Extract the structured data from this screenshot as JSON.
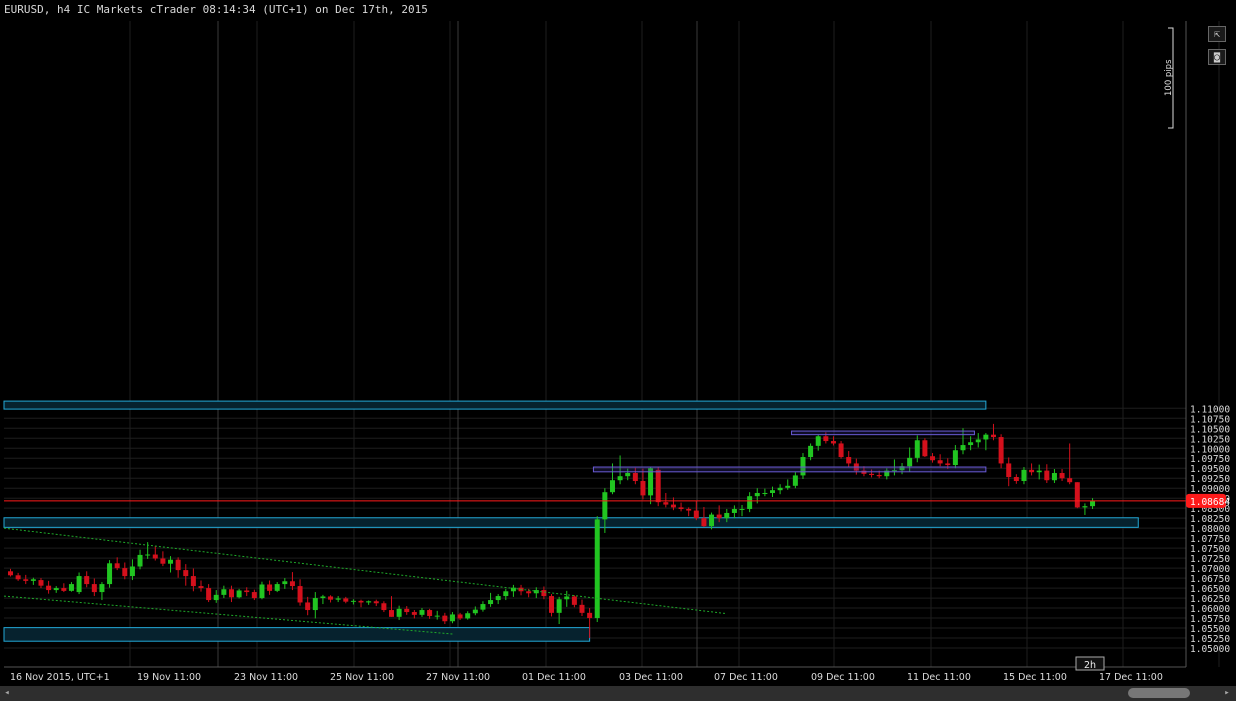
{
  "window": {
    "title": "EURUSD, h4 IC Markets cTrader 08:14:34 (UTC+1) on Dec 17th, 2015"
  },
  "toolbar": {
    "popout_icon": "popout-icon",
    "screenshot_icon": "camera-icon",
    "popout_glyph": "⇱",
    "screenshot_glyph": "◙"
  },
  "period_badge": "2h",
  "ruler_label": "100 pips",
  "scrollbar": {
    "left_arrow": "◂",
    "right_arrow": "▸"
  },
  "colors": {
    "background": "#000000",
    "grid": "#1e1e1e",
    "bull": "#21c521",
    "bear": "#d4101c",
    "price_line": "#ff1a1a",
    "zone_fill": "#06222e",
    "zone_stroke": "#23a8d6",
    "box_stroke": "#6a5bd6",
    "trend": "#1faa2a",
    "axis_text": "#dcdcdc"
  },
  "chart_data": {
    "type": "candlestick",
    "symbol": "EURUSD",
    "timeframe": "h4",
    "ylim": [
      1.049,
      1.1125
    ],
    "y_ticks": [
      "1.05000",
      "1.05250",
      "1.05500",
      "1.05750",
      "1.06000",
      "1.06250",
      "1.06500",
      "1.06750",
      "1.07000",
      "1.07250",
      "1.07500",
      "1.07750",
      "1.08000",
      "1.08250",
      "1.08500",
      "1.08750",
      "1.09000",
      "1.09250",
      "1.09500",
      "1.09750",
      "1.10000",
      "1.10250",
      "1.10500",
      "1.10750",
      "1.11000"
    ],
    "x_ticks": [
      "16 Nov 2015, UTC+1",
      "19 Nov 11:00",
      "23 Nov 11:00",
      "25 Nov 11:00",
      "27 Nov 11:00",
      "01 Dec 11:00",
      "03 Dec 11:00",
      "07 Dec 11:00",
      "09 Dec 11:00",
      "11 Dec 11:00",
      "15 Dec 11:00",
      "17 Dec 11:00"
    ],
    "current_price": {
      "value": 1.08684,
      "label": "1.08684"
    },
    "grid": true,
    "session_separators": [
      21,
      50,
      80
    ],
    "zones": [
      {
        "name": "supply-zone-top",
        "y1": 1.1098,
        "y2": 1.1118,
        "x1": 0,
        "x2": 128
      },
      {
        "name": "demand-zone-middle",
        "y1": 1.0802,
        "y2": 1.0826,
        "x1": 0,
        "x2": 148
      },
      {
        "name": "demand-zone-bottom",
        "y1": 1.0517,
        "y2": 1.0551,
        "x1": 0,
        "x2": 76
      }
    ],
    "boxes": [
      {
        "name": "resistance-box-upper",
        "y1": 1.1034,
        "y2": 1.1043,
        "x1": 102.5,
        "x2": 126.5
      },
      {
        "name": "resistance-box-lower",
        "y1": 1.0941,
        "y2": 1.0953,
        "x1": 76.5,
        "x2": 128
      }
    ],
    "trendlines": [
      {
        "name": "upper-trendline",
        "x1": 0,
        "y1": 1.08,
        "x2": 94,
        "y2": 1.0586
      },
      {
        "name": "lower-trendline",
        "x1": 0,
        "y1": 1.063,
        "x2": 58,
        "y2": 1.0535
      }
    ],
    "candles": [
      [
        1.0692,
        1.0698,
        1.0679,
        1.0682
      ],
      [
        1.0682,
        1.0688,
        1.0668,
        1.0672
      ],
      [
        1.0672,
        1.0683,
        1.066,
        1.0668
      ],
      [
        1.0668,
        1.0676,
        1.0658,
        1.0672
      ],
      [
        1.067,
        1.0675,
        1.065,
        1.0656
      ],
      [
        1.0656,
        1.0668,
        1.0636,
        1.0645
      ],
      [
        1.0645,
        1.0655,
        1.0638,
        1.065
      ],
      [
        1.065,
        1.0662,
        1.064,
        1.0643
      ],
      [
        1.0643,
        1.0665,
        1.0641,
        1.066
      ],
      [
        1.064,
        1.0689,
        1.0635,
        1.068
      ],
      [
        1.068,
        1.0692,
        1.0652,
        1.066
      ],
      [
        1.066,
        1.0674,
        1.063,
        1.064
      ],
      [
        1.064,
        1.0665,
        1.062,
        1.066
      ],
      [
        1.066,
        1.072,
        1.0651,
        1.0712
      ],
      [
        1.0712,
        1.0727,
        1.0695,
        1.07
      ],
      [
        1.07,
        1.0714,
        1.0672,
        1.068
      ],
      [
        1.068,
        1.0722,
        1.067,
        1.0704
      ],
      [
        1.0704,
        1.0746,
        1.0697,
        1.0733
      ],
      [
        1.0733,
        1.0765,
        1.0723,
        1.0734
      ],
      [
        1.0734,
        1.0755,
        1.0719,
        1.0724
      ],
      [
        1.0724,
        1.0742,
        1.0705,
        1.0711
      ],
      [
        1.0711,
        1.073,
        1.0689,
        1.0721
      ],
      [
        1.0721,
        1.0727,
        1.0676,
        1.0695
      ],
      [
        1.0695,
        1.071,
        1.0656,
        1.068
      ],
      [
        1.068,
        1.0699,
        1.0642,
        1.0655
      ],
      [
        1.0655,
        1.0669,
        1.0641,
        1.065
      ],
      [
        1.065,
        1.066,
        1.0615,
        1.062
      ],
      [
        1.062,
        1.0645,
        1.0613,
        1.0633
      ],
      [
        1.0633,
        1.0656,
        1.0625,
        1.0647
      ],
      [
        1.0647,
        1.0656,
        1.0615,
        1.0627
      ],
      [
        1.0627,
        1.0648,
        1.0624,
        1.0644
      ],
      [
        1.0644,
        1.0652,
        1.063,
        1.064
      ],
      [
        1.064,
        1.0646,
        1.062,
        1.0625
      ],
      [
        1.0625,
        1.0666,
        1.0622,
        1.0659
      ],
      [
        1.0659,
        1.0669,
        1.0633,
        1.0643
      ],
      [
        1.0643,
        1.0665,
        1.064,
        1.066
      ],
      [
        1.066,
        1.0675,
        1.0648,
        1.0667
      ],
      [
        1.0667,
        1.069,
        1.0645,
        1.0655
      ],
      [
        1.0655,
        1.0672,
        1.0606,
        1.0614
      ],
      [
        1.0614,
        1.0628,
        1.0582,
        1.0595
      ],
      [
        1.0595,
        1.064,
        1.0574,
        1.0625
      ],
      [
        1.0625,
        1.0633,
        1.061,
        1.0629
      ],
      [
        1.0629,
        1.0632,
        1.0614,
        1.0621
      ],
      [
        1.0621,
        1.063,
        1.0615,
        1.0624
      ],
      [
        1.0624,
        1.0628,
        1.0612,
        1.0616
      ],
      [
        1.0616,
        1.0622,
        1.0609,
        1.0618
      ],
      [
        1.0618,
        1.0621,
        1.0602,
        1.0614
      ],
      [
        1.0614,
        1.0619,
        1.0608,
        1.0617
      ],
      [
        1.0617,
        1.0621,
        1.0605,
        1.0612
      ],
      [
        1.0612,
        1.0617,
        1.059,
        1.0595
      ],
      [
        1.0595,
        1.063,
        1.0578,
        1.0578
      ],
      [
        1.0578,
        1.0606,
        1.057,
        1.0598
      ],
      [
        1.0598,
        1.0605,
        1.0583,
        1.059
      ],
      [
        1.059,
        1.0595,
        1.0574,
        1.0583
      ],
      [
        1.0583,
        1.06,
        1.0578,
        1.0595
      ],
      [
        1.0595,
        1.0598,
        1.0573,
        1.058
      ],
      [
        1.058,
        1.0593,
        1.0571,
        1.0581
      ],
      [
        1.0581,
        1.0588,
        1.056,
        1.0567
      ],
      [
        1.0567,
        1.059,
        1.0562,
        1.0584
      ],
      [
        1.0584,
        1.0588,
        1.057,
        1.0574
      ],
      [
        1.0574,
        1.0592,
        1.0571,
        1.0587
      ],
      [
        1.0587,
        1.0604,
        1.0582,
        1.0596
      ],
      [
        1.0596,
        1.0617,
        1.0591,
        1.061
      ],
      [
        1.061,
        1.0638,
        1.0603,
        1.062
      ],
      [
        1.062,
        1.0635,
        1.061,
        1.063
      ],
      [
        1.063,
        1.0648,
        1.062,
        1.0642
      ],
      [
        1.0642,
        1.0658,
        1.0628,
        1.0651
      ],
      [
        1.0651,
        1.0658,
        1.0632,
        1.0642
      ],
      [
        1.0642,
        1.0648,
        1.0627,
        1.0637
      ],
      [
        1.0637,
        1.0652,
        1.0625,
        1.0645
      ],
      [
        1.0645,
        1.0654,
        1.0622,
        1.063
      ],
      [
        1.063,
        1.0635,
        1.0579,
        1.0588
      ],
      [
        1.0588,
        1.0628,
        1.056,
        1.0622
      ],
      [
        1.0622,
        1.0643,
        1.0603,
        1.0629
      ],
      [
        1.0629,
        1.0632,
        1.0602,
        1.0608
      ],
      [
        1.0608,
        1.0621,
        1.058,
        1.0588
      ],
      [
        1.0588,
        1.06,
        1.0525,
        1.0575
      ],
      [
        1.0575,
        1.083,
        1.0565,
        1.0822
      ],
      [
        1.0822,
        1.09,
        1.0788,
        1.089
      ],
      [
        1.089,
        1.0962,
        1.0885,
        1.092
      ],
      [
        1.092,
        1.0982,
        1.091,
        1.093
      ],
      [
        1.093,
        1.0949,
        1.092,
        1.0938
      ],
      [
        1.0938,
        1.0951,
        1.091,
        1.0918
      ],
      [
        1.0918,
        1.0949,
        1.0872,
        1.0882
      ],
      [
        1.0882,
        1.0953,
        1.086,
        1.095
      ],
      [
        1.0946,
        1.0953,
        1.0855,
        1.0865
      ],
      [
        1.0865,
        1.0888,
        1.0852,
        1.0859
      ],
      [
        1.0859,
        1.0877,
        1.0845,
        1.0852
      ],
      [
        1.0852,
        1.0864,
        1.0842,
        1.0848
      ],
      [
        1.0848,
        1.0852,
        1.083,
        1.0844
      ],
      [
        1.0844,
        1.0868,
        1.082,
        1.0825
      ],
      [
        1.0825,
        1.0853,
        1.0803,
        1.0805
      ],
      [
        1.0805,
        1.0839,
        1.0797,
        1.0834
      ],
      [
        1.0834,
        1.0857,
        1.0815,
        1.0825
      ],
      [
        1.0825,
        1.0848,
        1.0815,
        1.0838
      ],
      [
        1.0838,
        1.0857,
        1.0825,
        1.0848
      ],
      [
        1.0848,
        1.0858,
        1.083,
        1.0848
      ],
      [
        1.0848,
        1.089,
        1.084,
        1.088
      ],
      [
        1.088,
        1.09,
        1.0862,
        1.0888
      ],
      [
        1.0888,
        1.0899,
        1.088,
        1.0888
      ],
      [
        1.0888,
        1.0904,
        1.0878,
        1.0895
      ],
      [
        1.0895,
        1.091,
        1.0885,
        1.0901
      ],
      [
        1.0901,
        1.0922,
        1.0896,
        1.0906
      ],
      [
        1.0906,
        1.094,
        1.09,
        1.0932
      ],
      [
        1.0932,
        1.0988,
        1.0923,
        1.0978
      ],
      [
        1.0978,
        1.1012,
        1.097,
        1.1006
      ],
      [
        1.1006,
        1.1034,
        1.0994,
        1.103
      ],
      [
        1.103,
        1.104,
        1.1012,
        1.1018
      ],
      [
        1.1018,
        1.103,
        1.1007,
        1.1012
      ],
      [
        1.1012,
        1.1018,
        1.0974,
        1.0978
      ],
      [
        1.0978,
        1.0993,
        1.0953,
        1.0962
      ],
      [
        1.0962,
        1.0974,
        1.0934,
        1.0944
      ],
      [
        1.0944,
        1.0955,
        1.093,
        1.0936
      ],
      [
        1.0936,
        1.0947,
        1.0927,
        1.0933
      ],
      [
        1.0933,
        1.0944,
        1.0925,
        1.093
      ],
      [
        1.093,
        1.095,
        1.0922,
        1.0944
      ],
      [
        1.0944,
        1.0972,
        1.0932,
        1.0945
      ],
      [
        1.0945,
        1.0963,
        1.0935,
        1.0955
      ],
      [
        1.0955,
        1.1002,
        1.0941,
        1.0976
      ],
      [
        1.0976,
        1.1032,
        1.0965,
        1.102
      ],
      [
        1.102,
        1.1025,
        1.0978,
        1.098
      ],
      [
        1.098,
        1.0988,
        1.0964,
        1.097
      ],
      [
        1.097,
        1.0985,
        1.0955,
        1.0962
      ],
      [
        1.0962,
        1.0975,
        1.0948,
        1.0958
      ],
      [
        1.0958,
        1.1008,
        1.095,
        1.0995
      ],
      [
        1.0995,
        1.105,
        1.0985,
        1.1008
      ],
      [
        1.1008,
        1.103,
        1.0995,
        1.1015
      ],
      [
        1.1015,
        1.1038,
        1.1002,
        1.1022
      ],
      [
        1.1022,
        1.1038,
        1.0995,
        1.1034
      ],
      [
        1.1034,
        1.1061,
        1.102,
        1.1028
      ],
      [
        1.1028,
        1.1035,
        1.095,
        1.0962
      ],
      [
        1.0962,
        1.0977,
        1.0905,
        1.0928
      ],
      [
        1.0928,
        1.0935,
        1.0911,
        1.0918
      ],
      [
        1.0918,
        1.0953,
        1.091,
        1.0946
      ],
      [
        1.0946,
        1.0962,
        1.0932,
        1.094
      ],
      [
        1.094,
        1.0959,
        1.0922,
        1.0944
      ],
      [
        1.0944,
        1.096,
        1.0913,
        1.092
      ],
      [
        1.092,
        1.0948,
        1.0913,
        1.0938
      ],
      [
        1.0938,
        1.0948,
        1.0918,
        1.0925
      ],
      [
        1.0925,
        1.1012,
        1.091,
        1.0915
      ],
      [
        1.0915,
        1.0915,
        1.085,
        1.0852
      ],
      [
        1.0852,
        1.0862,
        1.0833,
        1.0855
      ],
      [
        1.0855,
        1.0875,
        1.0848,
        1.0868
      ]
    ]
  }
}
